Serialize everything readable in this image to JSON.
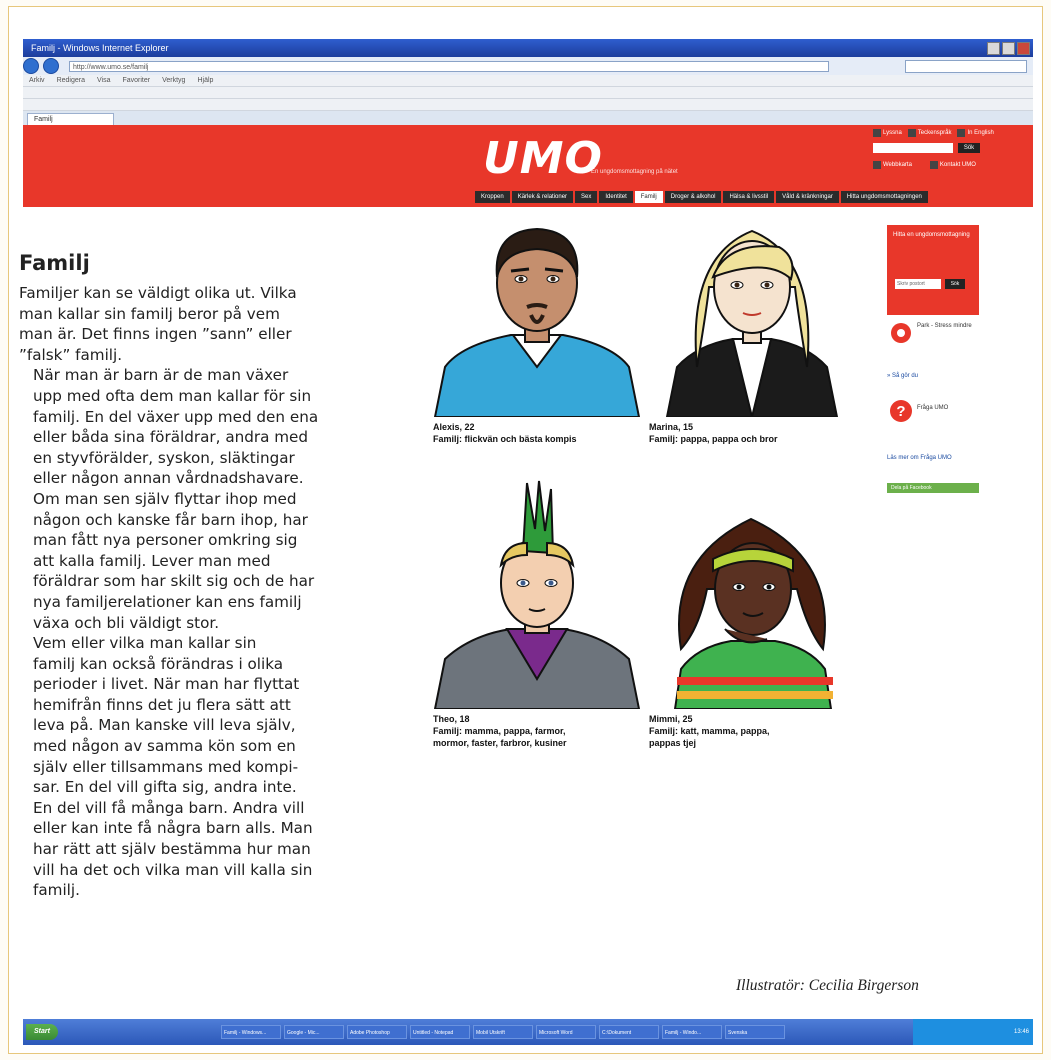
{
  "browser": {
    "title": "Familj - Windows Internet Explorer",
    "url": "http://www.umo.se/familj",
    "tab": "Familj"
  },
  "site": {
    "logo": "UMO",
    "tagline": "En ungdomsmottagning på nätet",
    "head_links": [
      "Lyssna",
      "Teckenspråk",
      "In English"
    ],
    "search_button": "Sök",
    "head_links2": [
      "Webbkarta",
      "Kontakt UMO"
    ],
    "nav": [
      "Kroppen",
      "Kärlek & relationer",
      "Sex",
      "Identitet",
      "Familj",
      "Droger & alkohol",
      "Hälsa & livsstil",
      "Våld & kränkningar",
      "Hitta ungdomsmottagningen"
    ],
    "nav_active": "Familj"
  },
  "people": [
    {
      "name": "Alexis, 22",
      "family": "Familj: flickvän och bästa kompis"
    },
    {
      "name": "Marina, 15",
      "family": "Familj: pappa, pappa och bror"
    },
    {
      "name": "Theo, 18",
      "family_lines": [
        "Familj: mamma, pappa, farmor,",
        "mormor, faster, farbror, kusiner"
      ]
    },
    {
      "name": "Mimmi, 25",
      "family_lines": [
        "Familj: katt, mamma, pappa,",
        "pappas tjej"
      ]
    }
  ],
  "sidebar": {
    "box_title": "Hitta en ungdomsmottagning",
    "box_input": "Skriv postort",
    "box_button": "Sök",
    "card1_title": "Park - Stress mindre",
    "card1_link": "» Så gör du",
    "card2_title": "Fråga UMO",
    "card2_link": "Läs mer om Fråga UMO",
    "green_label": "Dela på Facebook"
  },
  "taskbar": {
    "start": "Start",
    "items": [
      "Familj - Windows...",
      "Google - Mic...",
      "Adobe Photoshop",
      "Untitled - Notepad",
      "Mobil Utskrift",
      "Microsoft Word",
      "C:\\Dokument",
      "Familj - Windo...",
      "Svenska"
    ],
    "clock": "13:46"
  },
  "article": {
    "heading": "Familj",
    "paragraphs": [
      [
        "Familjer kan se väldigt olika ut. Vilka",
        "man kallar sin familj beror på vem",
        "man är. Det finns ingen ”sann” eller",
        "”falsk” familj."
      ],
      [
        "När man är barn är de man växer",
        "upp med ofta dem man kallar för sin",
        "familj. En del växer upp med den ena",
        "eller båda sina föräldrar, andra med",
        "en styvförälder, syskon, släktingar",
        "eller någon annan vårdnadshavare.",
        "Om man sen själv flyttar ihop med",
        "någon och kanske får barn ihop, har",
        "man fått nya personer omkring sig",
        "att kalla familj. Lever man med",
        "föräldrar som har skilt sig och de har",
        "nya familjerelationer kan ens familj",
        "växa och bli väldigt stor."
      ],
      [
        "Vem eller vilka man kallar sin",
        "familj kan också förändras i olika",
        "perioder i livet. När man har flyttat",
        "hemifrån finns det ju flera sätt att",
        "leva på. Man kanske vill leva själv,",
        "med någon av samma kön som en",
        "själv eller tillsammans med kompi-",
        "sar. En del vill gifta sig, andra inte.",
        "En del vill få många barn. Andra vill",
        "eller kan inte få några barn alls. Man",
        "har rätt att själv bestämma hur man",
        "vill ha det och vilka man vill kalla sin",
        "familj."
      ]
    ]
  },
  "credit": "Illustratör: Cecilia Birgerson"
}
